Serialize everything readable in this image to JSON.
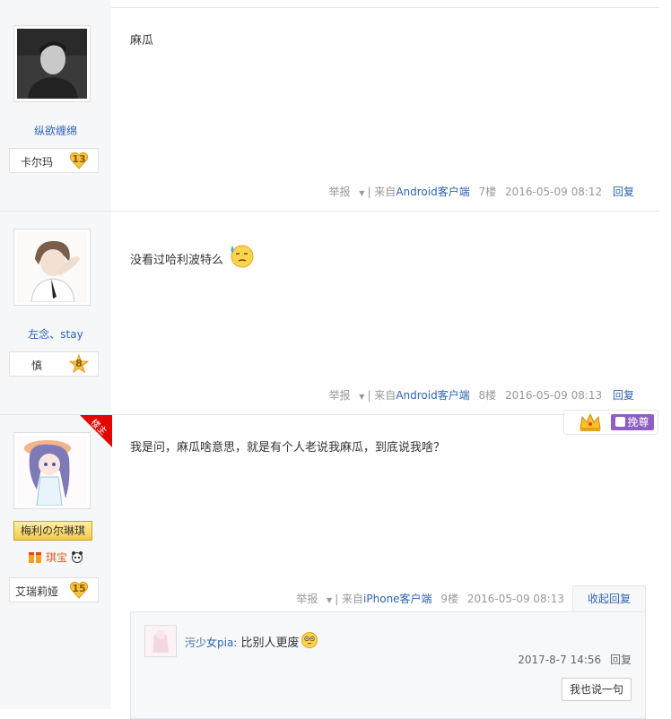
{
  "posts": [
    {
      "username": "纵欲缠绵",
      "badge": {
        "name": "卡尔玛",
        "level": "13"
      },
      "content": "麻瓜",
      "tail": {
        "report": "举报",
        "source_prefix": "| 来自",
        "source": "Android客户端",
        "floor": "7楼",
        "time": "2016-05-09 08:12",
        "reply": "回复"
      }
    },
    {
      "username": "左念、stay",
      "badge": {
        "name": "慎",
        "level": "8"
      },
      "content": "没看过哈利波特么",
      "tail": {
        "report": "举报",
        "source_prefix": "| 来自",
        "source": "Android客户端",
        "floor": "8楼",
        "time": "2016-05-09 08:13",
        "reply": "回复"
      }
    },
    {
      "louzhu_tag": "楼主",
      "username": "梅利の尔琳琪",
      "vip_name": "琪宝",
      "badge": {
        "name": "艾瑞莉娅",
        "level": "15"
      },
      "top_badge": "挽尊",
      "content": "我是问，麻瓜啥意思，就是有个人老说我麻瓜，到底说我啥？",
      "tail": {
        "report": "举报",
        "source_prefix": "| 来自",
        "source": "iPhone客户端",
        "floor": "9楼",
        "time": "2016-05-09 08:13"
      },
      "collapse_reply": "收起回复",
      "lzl": {
        "author": "污少女pia:",
        "text": "比别人更废",
        "time": "2017-8-7 14:56",
        "reply": "回复",
        "say_button": "我也说一句"
      }
    }
  ]
}
